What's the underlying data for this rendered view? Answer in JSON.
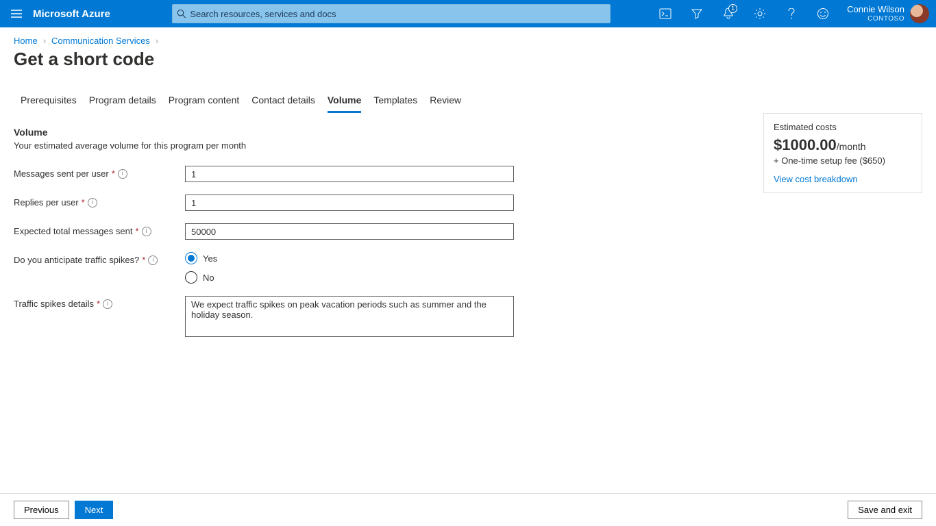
{
  "header": {
    "brand": "Microsoft Azure",
    "search_placeholder": "Search resources, services and docs",
    "notification_count": "1",
    "user_name": "Connie Wilson",
    "tenant": "CONTOSO"
  },
  "breadcrumbs": {
    "home": "Home",
    "svc": "Communication Services"
  },
  "page_title": "Get a short code",
  "tabs": {
    "prereq": "Prerequisites",
    "details": "Program details",
    "content": "Program content",
    "contact": "Contact details",
    "volume": "Volume",
    "templates": "Templates",
    "review": "Review"
  },
  "section": {
    "heading": "Volume",
    "sub": "Your estimated average volume for this program per month"
  },
  "labels": {
    "msgs_per_user": "Messages sent per user",
    "replies_per_user": "Replies per user",
    "total_msgs": "Expected total messages sent",
    "spikes_q": "Do you anticipate traffic spikes?",
    "spikes_details": "Traffic spikes details"
  },
  "values": {
    "msgs_per_user": "1",
    "replies_per_user": "1",
    "total_msgs": "50000",
    "spikes_yes": "Yes",
    "spikes_no": "No",
    "spikes_details_text": "We expect traffic spikes on peak vacation periods such as summer and the holiday season."
  },
  "cost": {
    "title": "Estimated costs",
    "amount": "$1000.00",
    "per": "/month",
    "fee": "+ One-time setup fee ($650)",
    "link": "View cost breakdown"
  },
  "footer": {
    "prev": "Previous",
    "next": "Next",
    "save": "Save and exit"
  }
}
